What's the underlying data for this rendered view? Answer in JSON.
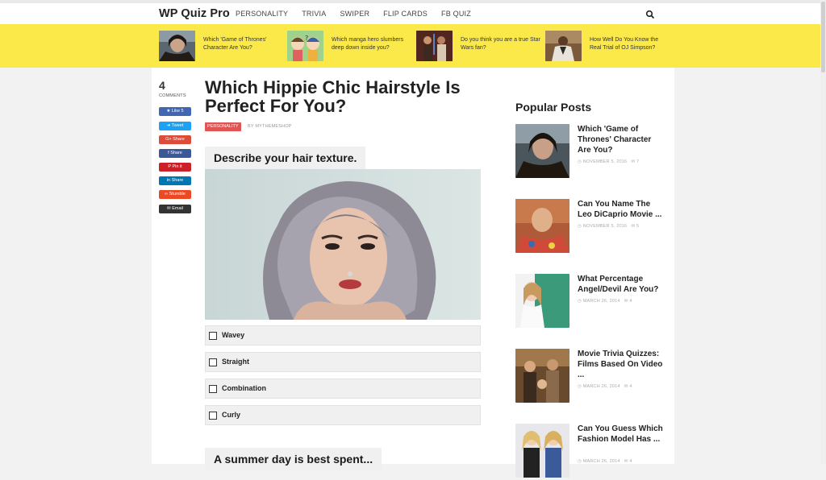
{
  "header": {
    "logo": "WP Quiz Pro",
    "nav": [
      "PERSONALITY",
      "TRIVIA",
      "SWIPER",
      "FLIP CARDS",
      "FB QUIZ"
    ]
  },
  "featured": [
    {
      "text": "Which 'Game of Thrones' Character Are You?",
      "thumb": "jon-snow-thumbnail"
    },
    {
      "text": "Which manga hero slumbers deep down inside you?",
      "thumb": "manga-heroes-thumbnail"
    },
    {
      "text": "Do you think you are a true Star Wars fan?",
      "thumb": "star-wars-thumbnail"
    },
    {
      "text": "How Well Do You Know the Real Trial of OJ Simpson?",
      "thumb": "oj-trial-thumbnail"
    }
  ],
  "share": {
    "comment_count": "4",
    "comment_label": "COMMENTS",
    "buttons": [
      {
        "label": "Like 5",
        "color": "#4267b2",
        "icon": "facebook-like-icon"
      },
      {
        "label": "Tweet",
        "color": "#1da1f2",
        "icon": "twitter-icon"
      },
      {
        "label": "Share",
        "color": "#dd4b39",
        "icon": "google-plus-icon",
        "prefix": "G+"
      },
      {
        "label": "Share",
        "color": "#3b5998",
        "icon": "facebook-icon",
        "prefix": "f"
      },
      {
        "label": "Pin it",
        "color": "#cb2027",
        "icon": "pinterest-icon",
        "prefix": "P"
      },
      {
        "label": "Share",
        "color": "#0077b5",
        "icon": "linkedin-icon",
        "prefix": "in"
      },
      {
        "label": "Stumble",
        "color": "#eb4924",
        "icon": "stumbleupon-icon"
      },
      {
        "label": "Email",
        "color": "#333333",
        "icon": "email-icon"
      }
    ]
  },
  "article": {
    "title": "Which Hippie Chic Hairstyle Is Perfect For You?",
    "category": "PERSONALITY",
    "byline_prefix": "BY",
    "author": "MYTHEMESHOP"
  },
  "quiz": {
    "question1": "Describe your hair texture.",
    "answers": [
      "Wavey",
      "Straight",
      "Combination",
      "Curly"
    ],
    "question2": "A summer day is best spent..."
  },
  "sidebar": {
    "title": "Popular Posts",
    "posts": [
      {
        "title": "Which 'Game of Thrones' Character Are You?",
        "date": "NOVEMBER 5, 2016",
        "comments": "7"
      },
      {
        "title": "Can You Name The Leo DiCaprio Movie ...",
        "date": "NOVEMBER 5, 2016",
        "comments": "5"
      },
      {
        "title": "What Percentage Angel/Devil Are You?",
        "date": "MARCH 26, 2014",
        "comments": "4"
      },
      {
        "title": "Movie Trivia Quizzes: Films Based On Video ...",
        "date": "MARCH 26, 2014",
        "comments": "4"
      },
      {
        "title": "Can You Guess Which Fashion Model Has ...",
        "date": "MARCH 26, 2014",
        "comments": "4"
      }
    ]
  }
}
